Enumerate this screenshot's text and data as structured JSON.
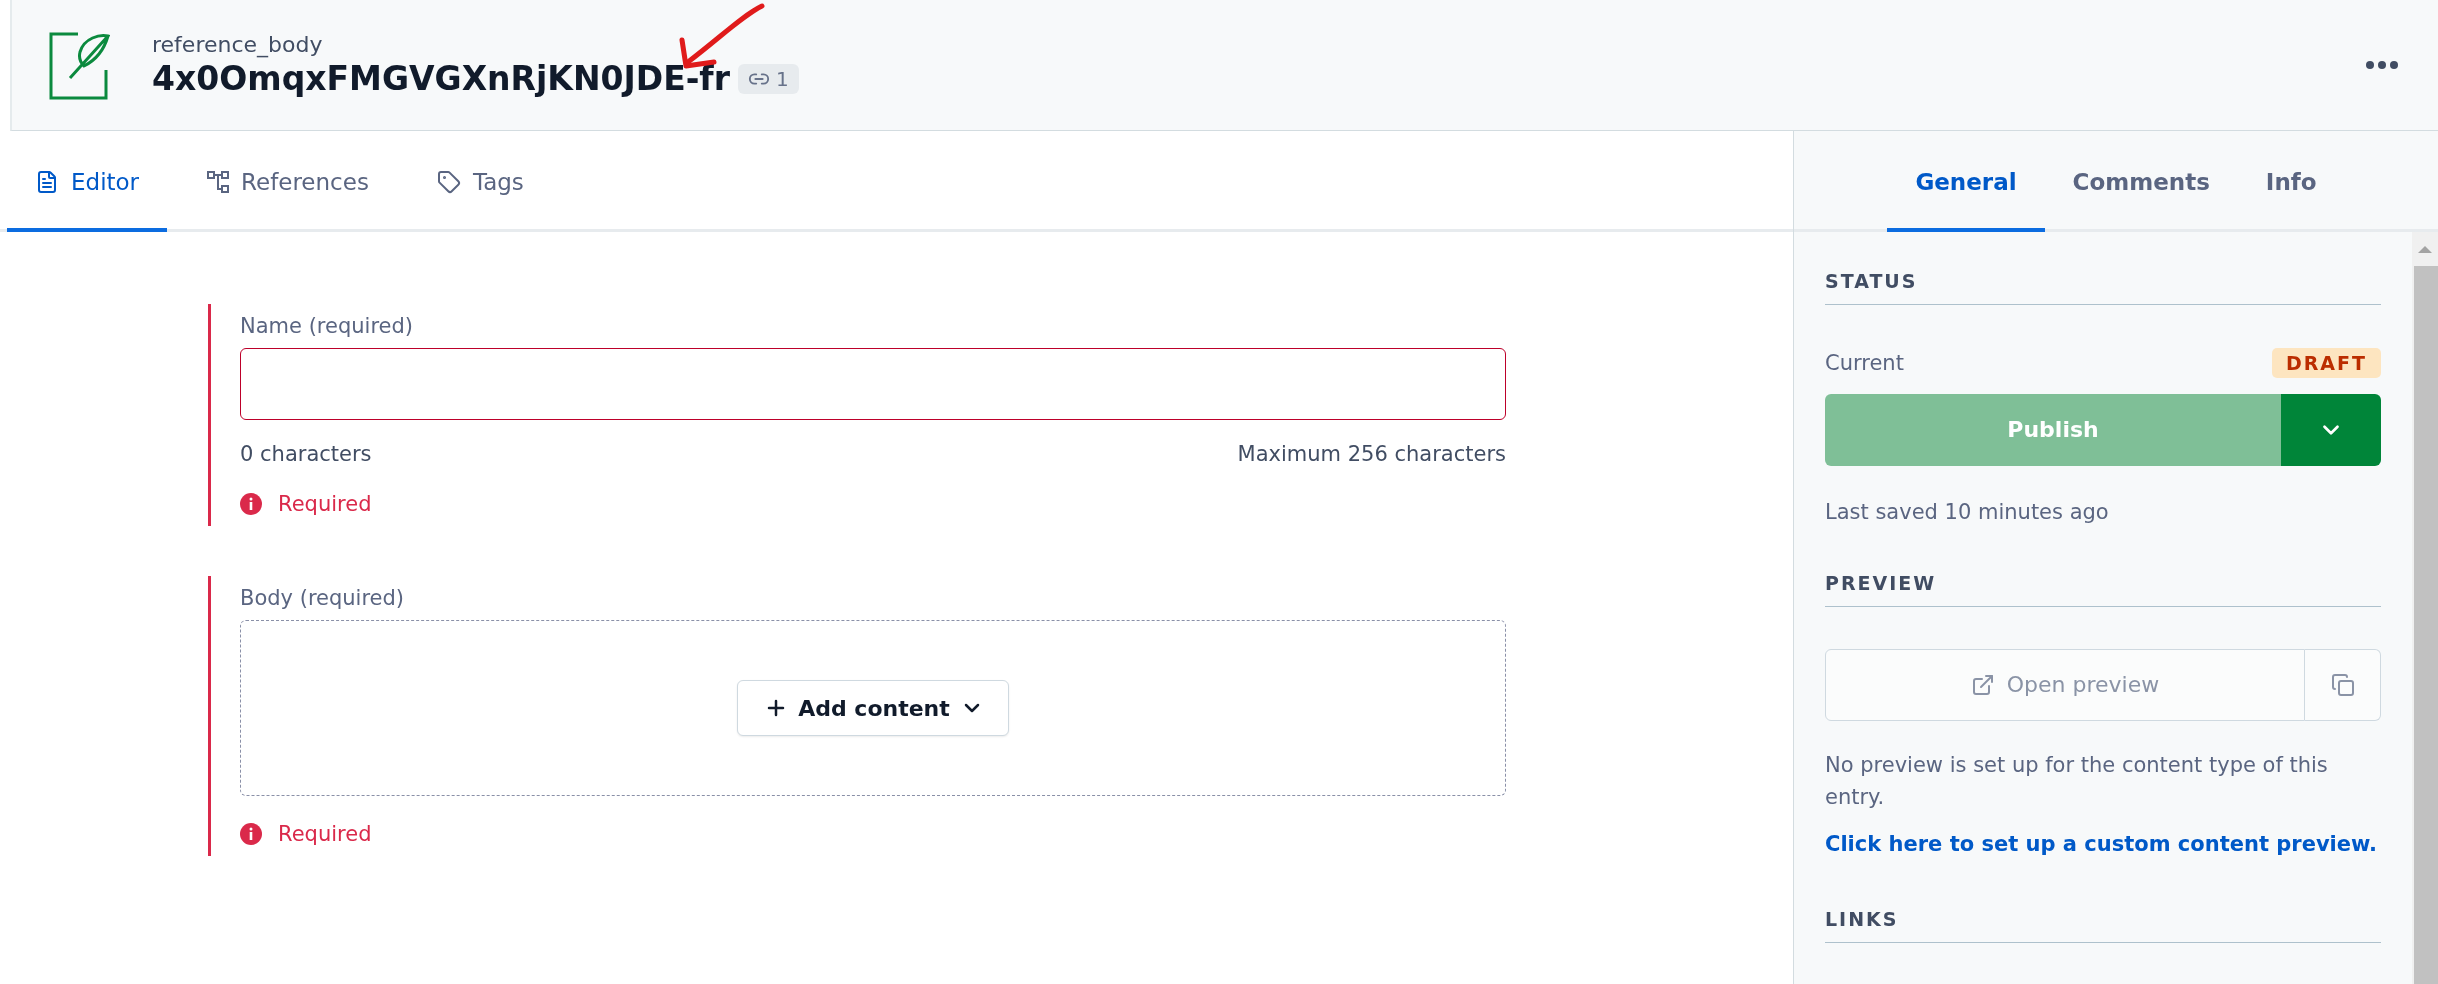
{
  "header": {
    "content_type": "reference_body",
    "title": "4x0OmqxFMGVGXnRjKN0JDE-fr",
    "link_count": "1"
  },
  "editor_tabs": [
    {
      "kind": "editor",
      "label": "Editor",
      "selected": true
    },
    {
      "kind": "references",
      "label": "References",
      "selected": false
    },
    {
      "kind": "tags",
      "label": "Tags",
      "selected": false
    }
  ],
  "sidebar_tabs": [
    {
      "label": "General",
      "selected": true
    },
    {
      "label": "Comments",
      "selected": false
    },
    {
      "label": "Info",
      "selected": false
    }
  ],
  "fields": [
    {
      "kind": "text",
      "label": "Name (required)",
      "invalid": true,
      "char_count": "0 characters",
      "char_max": "Maximum 256 characters",
      "error": "Required"
    },
    {
      "kind": "rich",
      "label": "Body (required)",
      "invalid": true,
      "add_button": "Add content",
      "error": "Required"
    }
  ],
  "status": {
    "heading": "STATUS",
    "current_label": "Current",
    "badge": "DRAFT",
    "publish_button": "Publish",
    "publish_disabled": true,
    "last_saved": "Last saved 10 minutes ago"
  },
  "preview": {
    "heading": "PREVIEW",
    "open_button": "Open preview",
    "disabled": true,
    "note": "No preview is set up for the content type of this entry.",
    "link": "Click here to set up a custom content preview."
  },
  "links": {
    "heading": "LINKS"
  }
}
